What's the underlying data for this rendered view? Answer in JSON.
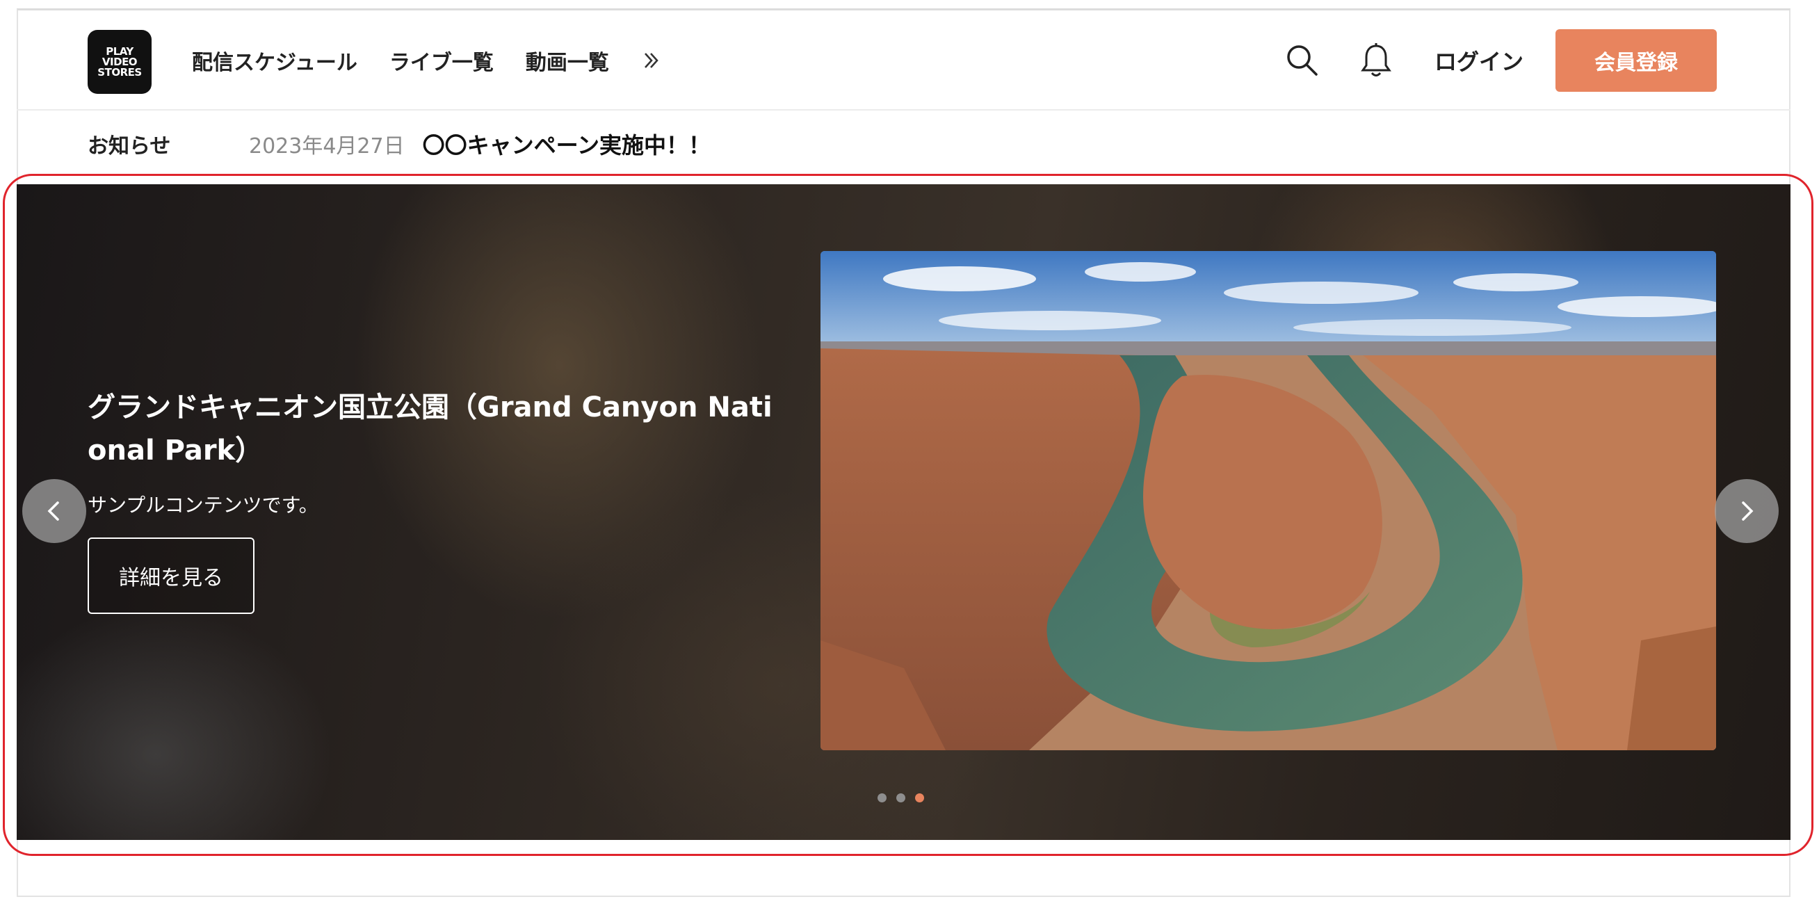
{
  "logo": {
    "line1": "PLAY",
    "line2": "VIDEO",
    "line3": "STORES"
  },
  "nav": {
    "items": [
      {
        "label": "配信スケジュール"
      },
      {
        "label": "ライブ一覧"
      },
      {
        "label": "動画一覧"
      }
    ],
    "more_icon": "double-chevron-right-icon"
  },
  "header_right": {
    "search_icon": "search-icon",
    "bell_icon": "bell-icon",
    "login_label": "ログイン",
    "signup_label": "会員登録"
  },
  "news": {
    "label": "お知らせ",
    "date": "2023年4月27日",
    "title": "〇〇キャンペーン実施中！！"
  },
  "hero": {
    "title": "グランドキャニオン国立公園（Grand Canyon National Park）",
    "subtitle": "サンプルコンテンツです。",
    "button_label": "詳細を見る",
    "image_subject": "horseshoe-bend-canyon",
    "slides_total": 3,
    "active_slide": 3
  },
  "colors": {
    "accent": "#e8845e",
    "highlight_border": "#e0242c"
  }
}
